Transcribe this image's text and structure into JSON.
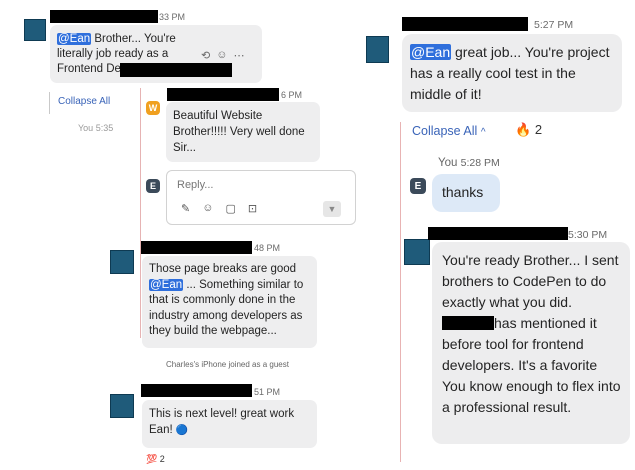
{
  "left": {
    "msg1": {
      "time": "33 PM",
      "mention": "@Ean",
      "text_after": " Brother... You're literally job ready as a Frontend Developer..."
    },
    "collapse_all": "Collapse All",
    "you_time_faded": "You 5:35",
    "reply1": {
      "avatar_letter": "W",
      "time": "6 PM",
      "text": "Beautiful Website Brother!!!!! Very well done Sir..."
    },
    "reply_box": {
      "avatar_letter": "E",
      "placeholder": "Reply..."
    },
    "msg2": {
      "time": "48 PM",
      "text_before": "Those page breaks are good ",
      "mention": "@Ean",
      "text_after": " ... Something similar to that is commonly done in the industry among developers as they build the webpage..."
    },
    "system_note": "Charles's iPhone joined as a guest",
    "msg3": {
      "time": "51 PM",
      "text": "This is next level! great work Ean! ",
      "globe_emoji": "🔵",
      "reaction_emoji": "💯",
      "reaction_count": "2"
    }
  },
  "right": {
    "msg1": {
      "time": "5:27 PM",
      "mention": "@Ean",
      "text_after": " great job... You're project has a really cool test in the middle of it!"
    },
    "collapse_all": "Collapse All",
    "reaction_emoji": "🔥",
    "reaction_count": "2",
    "you_reply": {
      "avatar_letter": "E",
      "name": "You",
      "time": "5:28 PM",
      "text": "thanks"
    },
    "msg2": {
      "time": "5:30 PM",
      "text_part1": "You're ready Brother... I sent brothers to CodePen to do exactly what you did.",
      "text_part2": "has mentioned it before tool for frontend developers. It's a favorite  You know enough to flex into a professional result."
    }
  },
  "colors": {
    "mention_bg": "#2f6fdc",
    "avatar_blue": "#1f5b7a",
    "link_blue": "#3a64b8",
    "orange_avatar": "#f0a020",
    "dark_avatar": "#3b4a5a"
  }
}
